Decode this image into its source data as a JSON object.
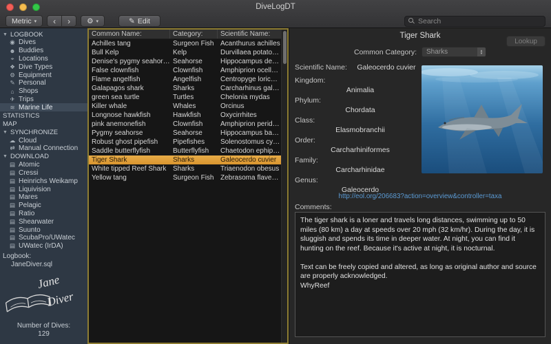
{
  "window": {
    "title": "DiveLogDT"
  },
  "toolbar": {
    "metric_label": "Metric",
    "back_icon": "‹",
    "forward_icon": "›",
    "gear_icon": "⚙",
    "chevron_icon": "▾",
    "pencil_icon": "✎",
    "edit_label": "Edit",
    "search_placeholder": "Search"
  },
  "sidebar": {
    "entries": [
      {
        "type": "header",
        "label": "LOGBOOK",
        "expanded": true
      },
      {
        "type": "item",
        "label": "Dives",
        "icon": "◉"
      },
      {
        "type": "item",
        "label": "Buddies",
        "icon": "☻"
      },
      {
        "type": "item",
        "label": "Locations",
        "icon": "⌖"
      },
      {
        "type": "item",
        "label": "Dive Types",
        "icon": "❖"
      },
      {
        "type": "item",
        "label": "Equipment",
        "icon": "⚙"
      },
      {
        "type": "item",
        "label": "Personal",
        "icon": "✎"
      },
      {
        "type": "item",
        "label": "Shops",
        "icon": "⌂"
      },
      {
        "type": "item",
        "label": "Trips",
        "icon": "✈"
      },
      {
        "type": "item",
        "label": "Marine Life",
        "icon": "≋",
        "selected": true
      },
      {
        "type": "header",
        "label": "STATISTICS"
      },
      {
        "type": "header",
        "label": "MAP"
      },
      {
        "type": "header",
        "label": "SYNCHRONIZE",
        "expanded": true
      },
      {
        "type": "item",
        "label": "Cloud",
        "icon": "☁"
      },
      {
        "type": "item",
        "label": "Manual Connection",
        "icon": "⇄"
      },
      {
        "type": "header",
        "label": "DOWNLOAD",
        "expanded": true
      },
      {
        "type": "item",
        "label": "Atomic",
        "icon": "▤"
      },
      {
        "type": "item",
        "label": "Cressi",
        "icon": "▤"
      },
      {
        "type": "item",
        "label": "Heinrichs Weikamp",
        "icon": "▤"
      },
      {
        "type": "item",
        "label": "Liquivision",
        "icon": "▤"
      },
      {
        "type": "item",
        "label": "Mares",
        "icon": "▤"
      },
      {
        "type": "item",
        "label": "Pelagic",
        "icon": "▤"
      },
      {
        "type": "item",
        "label": "Ratio",
        "icon": "▤"
      },
      {
        "type": "item",
        "label": "Shearwater",
        "icon": "▤"
      },
      {
        "type": "item",
        "label": "Suunto",
        "icon": "▤"
      },
      {
        "type": "item",
        "label": "ScubaPro/UWatec",
        "icon": "▤"
      },
      {
        "type": "item",
        "label": "UWatec (IrDA)",
        "icon": "▤"
      }
    ],
    "logbook_label": "Logbook:",
    "logbook_file": "JaneDiver.sql",
    "logo_line1": "Jane",
    "logo_line2": "Diver",
    "dive_count_label": "Number of Dives:",
    "dive_count": "129"
  },
  "table": {
    "columns": [
      "Common Name:",
      "Category:",
      "Scientific Name:"
    ],
    "selected_index": 13,
    "rows": [
      {
        "common": "Achilles tang",
        "category": "Surgeon Fish",
        "scientific": "Acanthurus achilles"
      },
      {
        "common": "Bull Kelp",
        "category": "Kelp",
        "scientific": "Durvillaea potatorum"
      },
      {
        "common": "Denise's pygmy seahorse",
        "category": "Seahorse",
        "scientific": "Hippocampus denise"
      },
      {
        "common": "False clownfish",
        "category": "Clownfish",
        "scientific": "Amphiprion ocellaris"
      },
      {
        "common": "Flame angelfish",
        "category": "Angelfish",
        "scientific": "Centropyge loriculus"
      },
      {
        "common": "Galapagos shark",
        "category": "Sharks",
        "scientific": "Carcharhinus galapagen..."
      },
      {
        "common": "green sea turtle",
        "category": "Turtles",
        "scientific": "Chelonia mydas"
      },
      {
        "common": "Killer whale",
        "category": "Whales",
        "scientific": "Orcinus"
      },
      {
        "common": "Longnose hawkfish",
        "category": "Hawkfish",
        "scientific": "Oxycirrhites"
      },
      {
        "common": "pink anemonefish",
        "category": "Clownfish",
        "scientific": "Amphiprion perideraion"
      },
      {
        "common": "Pygmy seahorse",
        "category": "Seahorse",
        "scientific": "Hippocampus bargibanti"
      },
      {
        "common": "Robust ghost pipefish",
        "category": "Pipefishes",
        "scientific": "Solenostomus cyanopter..."
      },
      {
        "common": "Saddle butterflyfish",
        "category": "Butterflyfish",
        "scientific": "Chaetodon ephippium"
      },
      {
        "common": "Tiger Shark",
        "category": "Sharks",
        "scientific": "Galeocerdo cuvier"
      },
      {
        "common": "White tipped Reef Shark",
        "category": "Sharks",
        "scientific": "Triaenodon obesus"
      },
      {
        "common": "Yellow tang",
        "category": "Surgeon Fish",
        "scientific": "Zebrasoma flavescens"
      }
    ]
  },
  "detail": {
    "title": "Tiger Shark",
    "lookup_label": "Lookup",
    "common_category_label": "Common Category:",
    "common_category_value": "Sharks",
    "fields": [
      {
        "label": "Scientific Name:",
        "value": "Galeocerdo cuvier",
        "inline": true
      },
      {
        "label": "Kingdom:",
        "value": "Animalia"
      },
      {
        "label": "Phylum:",
        "value": "Chordata"
      },
      {
        "label": "Class:",
        "value": "Elasmobranchii"
      },
      {
        "label": "Order:",
        "value": "Carcharhiniformes"
      },
      {
        "label": "Family:",
        "value": "Carcharhinidae"
      },
      {
        "label": "Genus:",
        "value": "Galeocerdo"
      }
    ],
    "link": "http://eol.org/206683?action=overview&controller=taxa",
    "comments_label": "Comments:",
    "comments": "The tiger shark is a loner and travels long distances, swimming up to 50 miles (80 km) a day at speeds over 20 mph (32 km/hr). During the day, it is sluggish and spends its time in deeper water. At night, you can find it hunting on the reef. Because it's active at night, it is nocturnal.\n\nText can be freely copied and altered, as long as original author and source are properly acknowledged.\nWhyReef"
  },
  "colors": {
    "selection": "#d9952f",
    "table_border": "#8e7d33",
    "link": "#5b9bd5",
    "sidebar_bg": "#2e3844"
  }
}
